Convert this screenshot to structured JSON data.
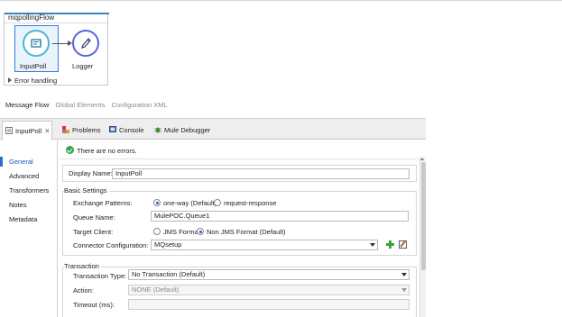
{
  "flow": {
    "title": "mqpollingFlow",
    "nodes": [
      {
        "label": "InputPoll",
        "icon": "poll-icon"
      },
      {
        "label": "Logger",
        "icon": "logger-pen-icon"
      }
    ],
    "error_handling": "Error handling"
  },
  "message_flow_tabs": [
    "Message Flow",
    "Global Elements",
    "Configuration XML"
  ],
  "editor_tabs": [
    "InputPoll",
    "Problems",
    "Console",
    "Mule Debugger"
  ],
  "left_nav": [
    "General",
    "Advanced",
    "Transformers",
    "Notes",
    "Metadata"
  ],
  "status": "There are no errors.",
  "display_name": {
    "label": "Display Name:",
    "value": "InputPoll"
  },
  "basic_settings": {
    "title": "Basic Settings",
    "exchange_patterns_label": "Exchange Patterns:",
    "exchange_patterns_options": [
      "one-way (Default)",
      "request-response"
    ],
    "exchange_patterns_selected": "one-way (Default)",
    "queue_name_label": "Queue Name:",
    "queue_name_value": "MulePOC.Queue1",
    "target_client_label": "Target Client:",
    "target_client_options": [
      "JMS Format",
      "Non JMS Format (Default)"
    ],
    "target_client_selected": "Non JMS Format (Default)",
    "connector_config_label": "Connector Configuration:",
    "connector_config_value": "MQsetup"
  },
  "transaction": {
    "title": "Transaction",
    "type_label": "Transaction Type:",
    "type_value": "No Transaction (Default)",
    "action_label": "Action:",
    "action_value": "NONE (Default)",
    "timeout_label": "Timeout (ms):"
  },
  "colors": {
    "accent": "#3a84c2",
    "poll": "#49b6d6",
    "logger": "#5a66d8",
    "ok": "#2ea84a"
  }
}
